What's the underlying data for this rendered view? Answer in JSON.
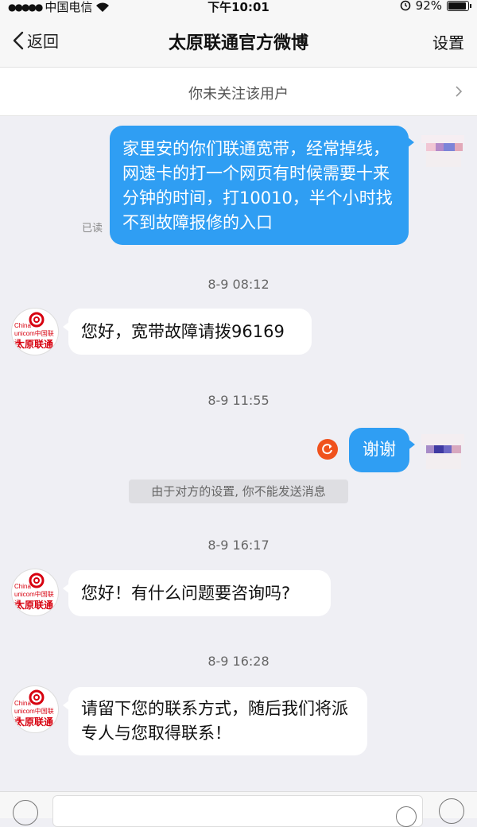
{
  "status_bar": {
    "carrier": "中国电信",
    "time": "下午10:01",
    "battery": "92%",
    "battery_level": 0.92
  },
  "nav": {
    "back_label": "返回",
    "title": "太原联通官方微博",
    "settings_label": "设置"
  },
  "follow_banner": {
    "text": "你未关注该用户"
  },
  "messages": [
    {
      "direction": "out",
      "text": "家里安的你们联通宽带，经常掉线，网速卡的打一个网页有时候需要十来分钟的时间，打10010，半个小时找不到故障报修的入口",
      "status": "已读"
    },
    {
      "timestamp": "8-9 08:12"
    },
    {
      "direction": "in",
      "text": "您好，宽带故障请拨96169"
    },
    {
      "timestamp": "8-9 11:55"
    },
    {
      "direction": "out",
      "text": "谢谢",
      "failed": true
    },
    {
      "system_note": "由于对方的设置, 你不能发送消息"
    },
    {
      "timestamp": "8-9 16:17"
    },
    {
      "direction": "in",
      "text": "您好！有什么问题要咨询吗?"
    },
    {
      "timestamp": "8-9 16:28"
    },
    {
      "direction": "in",
      "text": "请留下您的联系方式，随后我们将派专人与您取得联系！"
    }
  ],
  "logo": {
    "line1": "China",
    "line2": "unicom中国联通",
    "line3": "太原联通"
  },
  "colors": {
    "outgoing_bubble": "#2f9ef3",
    "incoming_bubble": "#ffffff",
    "background": "#efeff4",
    "retry_icon": "#f0521d",
    "logo_red": "#d7000f"
  },
  "icons": [
    "wifi-icon",
    "alarm-lock-icon",
    "battery-icon",
    "back-chevron-icon",
    "chevron-right-icon",
    "retry-icon",
    "voice-icon",
    "emoji-icon",
    "plus-icon"
  ]
}
